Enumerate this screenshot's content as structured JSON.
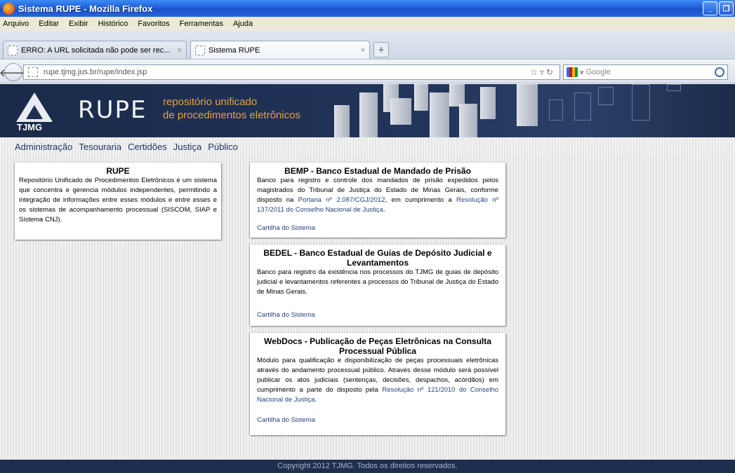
{
  "window": {
    "title": "Sistema RUPE - Mozilla Firefox"
  },
  "menu": [
    "Arquivo",
    "Editar",
    "Exibir",
    "Histórico",
    "Favoritos",
    "Ferramentas",
    "Ajuda"
  ],
  "tabs": [
    {
      "label": "ERRO: A URL solicitada não pode ser rec...",
      "close": "×"
    },
    {
      "label": "Sistema RUPE",
      "close": "×"
    }
  ],
  "newtab_label": "+",
  "navbar": {
    "url": "rupe.tjmg.jus.br/rupe/index.jsp",
    "search_placeholder": "Google"
  },
  "banner": {
    "org": "TJMG",
    "app": "RUPE",
    "tagline_1": "repositório unificado",
    "tagline_2": "de procedimentos eletrônicos"
  },
  "mainnav": [
    "Administração",
    "Tesouraria",
    "Certidões",
    "Justiça",
    "Público"
  ],
  "rupe_card": {
    "title": "RUPE",
    "body": "Repositório Unificado de Procedimentos Eletrônicos é um sistema que concentra e gerencia módulos independentes, permitindo a integração de informações entre esses módulos e entre esses e os sistemas de acompanhamento processual (SISCOM, SIAP e Sistema CNJ)."
  },
  "modules": [
    {
      "title": "BEMP - Banco Estadual de Mandado de Prisão",
      "body_a": "Banco para registro e controle dos mandados de prisão expedidos pelos magistrados do Tribunal de Justiça do Estado de Minas Gerais, conforme disposto na ",
      "link_1": "Portaria nº 2.087/CGJ/2012",
      "body_b": ", em cumprimento a ",
      "link_2": "Resolução nº 137/2011 do Conselho Nacional de Justiça",
      "body_c": ".",
      "cartilha": "Cartilha do Sistema"
    },
    {
      "title": "BEDEL - Banco Estadual de Guias de Depósito Judicial e Levantamentos",
      "body_a": "Banco para registro da existência nos processos do TJMG de guias de depósito judicial e levantamentos referentes a processos do Tribunal de Justiça do Estado de Minas Gerais.",
      "cartilha": "Cartilha do Sistema"
    },
    {
      "title": "WebDocs - Publicação de Peças Eletrônicas na Consulta Processual Pública",
      "body_a": "Módulo para qualificação e disponibilização de peças processuais eletrônicas através do andamento processual público. Através desse módulo será possível publicar os atos judiciais (sentenças, decisões, despachos, acórdãos) em cumprimento a parte do disposto pela ",
      "link_1": "Resolução nº 121/2010 do Conselho Nacional de Justiça",
      "body_b": ".",
      "cartilha": "Cartilha do Sistema"
    }
  ],
  "footer": "Copyright 2012 TJMG. Todos os direitos reservados."
}
